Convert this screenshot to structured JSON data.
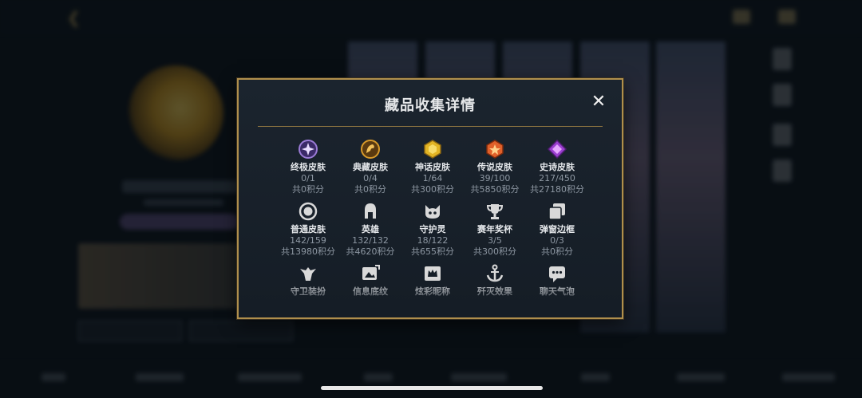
{
  "modal": {
    "title": "藏品收集详情",
    "close_label": "✕"
  },
  "rows": [
    [
      {
        "name": "终极皮肤",
        "count": "0/1",
        "points": "共0积分",
        "icon": "ultimate-skin-icon",
        "color": "#9b7bd6"
      },
      {
        "name": "典藏皮肤",
        "count": "0/4",
        "points": "共0积分",
        "icon": "collection-skin-icon",
        "color": "#d89a2a"
      },
      {
        "name": "神话皮肤",
        "count": "1/64",
        "points": "共300积分",
        "icon": "mythic-skin-icon",
        "color": "#e2b424"
      },
      {
        "name": "传说皮肤",
        "count": "39/100",
        "points": "共5850积分",
        "icon": "legend-skin-icon",
        "color": "#e0602a"
      },
      {
        "name": "史诗皮肤",
        "count": "217/450",
        "points": "共27180积分",
        "icon": "epic-skin-icon",
        "color": "#9b3fd0"
      }
    ],
    [
      {
        "name": "普通皮肤",
        "count": "142/159",
        "points": "共13980积分",
        "icon": "normal-skin-icon",
        "color": "#d9d9d9"
      },
      {
        "name": "英雄",
        "count": "132/132",
        "points": "共4620积分",
        "icon": "hero-helmet-icon",
        "color": "#d9d9d9"
      },
      {
        "name": "守护灵",
        "count": "18/122",
        "points": "共655积分",
        "icon": "guardian-spirit-icon",
        "color": "#d9d9d9"
      },
      {
        "name": "赛年奖杯",
        "count": "3/5",
        "points": "共300积分",
        "icon": "trophy-icon",
        "color": "#d9d9d9"
      },
      {
        "name": "弹窗边框",
        "count": "0/3",
        "points": "共0积分",
        "icon": "popup-frame-icon",
        "color": "#d9d9d9"
      }
    ],
    [
      {
        "name": "守卫装扮",
        "icon": "guard-outfit-icon",
        "color": "#d9d9d9"
      },
      {
        "name": "信息底纹",
        "icon": "info-background-icon",
        "color": "#d9d9d9"
      },
      {
        "name": "炫彩昵称",
        "icon": "crown-nickname-icon",
        "color": "#d9d9d9"
      },
      {
        "name": "歼灭效果",
        "icon": "anchor-effect-icon",
        "color": "#d9d9d9"
      },
      {
        "name": "聊天气泡",
        "icon": "chat-bubble-icon",
        "color": "#d9d9d9"
      }
    ]
  ]
}
